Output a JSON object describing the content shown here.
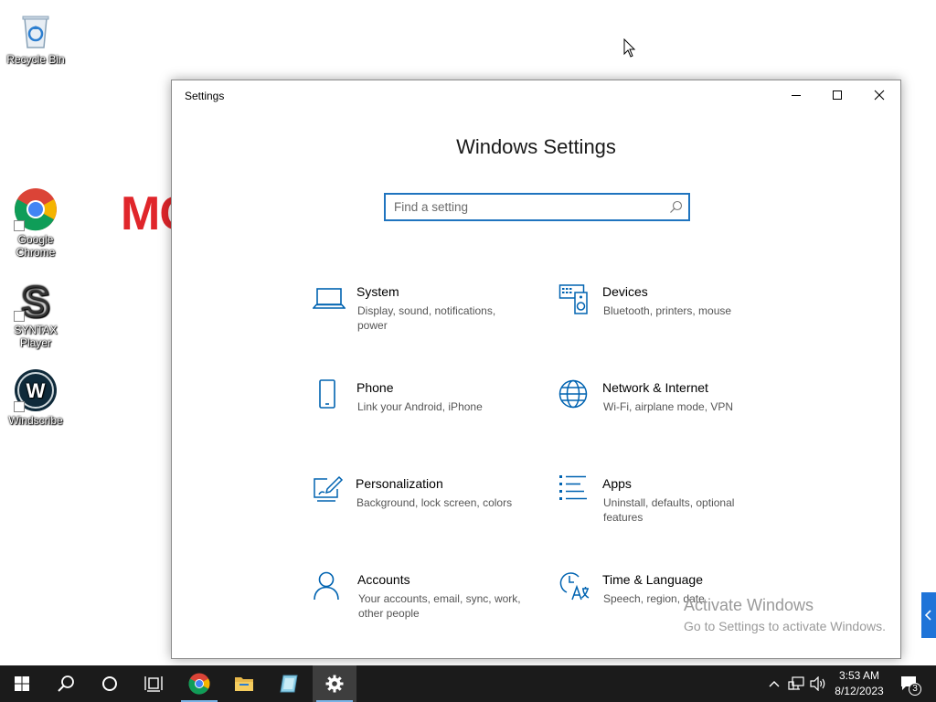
{
  "desktop": {
    "icons": [
      {
        "label": "Recycle Bin"
      },
      {
        "label": "Google Chrome"
      },
      {
        "label": "SYNTAX Player"
      },
      {
        "label": "Windscribe"
      }
    ],
    "background_text": "MC"
  },
  "window": {
    "title": "Settings",
    "heading": "Windows Settings",
    "search": {
      "placeholder": "Find a setting",
      "value": ""
    },
    "categories": [
      {
        "name": "System",
        "description": "Display, sound, notifications, power",
        "icon": "laptop-icon"
      },
      {
        "name": "Devices",
        "description": "Bluetooth, printers, mouse",
        "icon": "devices-icon"
      },
      {
        "name": "Phone",
        "description": "Link your Android, iPhone",
        "icon": "phone-icon"
      },
      {
        "name": "Network & Internet",
        "description": "Wi-Fi, airplane mode, VPN",
        "icon": "globe-icon"
      },
      {
        "name": "Personalization",
        "description": "Background, lock screen, colors",
        "icon": "paint-icon"
      },
      {
        "name": "Apps",
        "description": "Uninstall, defaults, optional features",
        "icon": "apps-list-icon"
      },
      {
        "name": "Accounts",
        "description": "Your accounts, email, sync, work, other people",
        "icon": "person-icon"
      },
      {
        "name": "Time & Language",
        "description": "Speech, region, date",
        "icon": "time-language-icon"
      }
    ]
  },
  "watermark": {
    "line1": "Activate Windows",
    "line2": "Go to Settings to activate Windows."
  },
  "taskbar": {
    "time": "3:53 AM",
    "date": "8/12/2023",
    "notification_count": "3"
  },
  "colors": {
    "accent": "#0063b1",
    "search_border": "#1f74bf",
    "taskbar": "#1b1b1b"
  }
}
